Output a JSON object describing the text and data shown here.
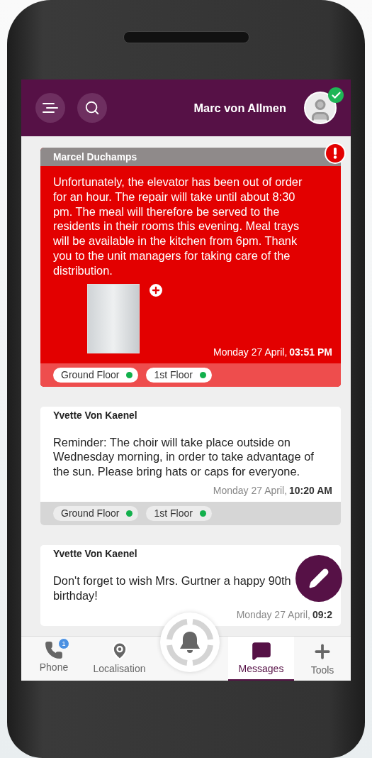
{
  "header": {
    "user_name": "Marc von Allmen",
    "online": true
  },
  "messages": [
    {
      "sender": "Marcel Duchamps",
      "urgent": true,
      "text": "Unfortunately, the elevator has been out of order for an hour. The repair will take until about 8:30 pm. The meal will therefore be served to the residents in their rooms this evening. Meal trays will be available in the kitchen from 6pm. Thank you to the unit managers for taking care of the distribution.",
      "has_photo": true,
      "date": "Monday 27 April,",
      "time": "03:51 PM",
      "tags": [
        "Ground Floor",
        "1st Floor"
      ]
    },
    {
      "sender": "Yvette Von Kaenel",
      "urgent": false,
      "text": "Reminder: The choir will take place outside on Wednesday morning, in order to take advantage of the sun. Please bring hats or caps for everyone.",
      "has_photo": false,
      "date": "Monday 27 April,",
      "time": "10:20 AM",
      "tags": [
        "Ground Floor",
        "1st Floor"
      ]
    },
    {
      "sender": "Yvette Von Kaenel",
      "urgent": false,
      "text": "Don't forget to wish Mrs. Gurtner a happy 90th birthday!",
      "has_photo": false,
      "date": "Monday 27 April,",
      "time": "09:2"
    }
  ],
  "nav": [
    {
      "kind": "phone",
      "label": "Phone",
      "badge": "1",
      "selected": false
    },
    {
      "kind": "location",
      "label": "Localisation",
      "selected": false
    },
    {
      "kind": "alarm",
      "selected": false
    },
    {
      "kind": "messages",
      "label": "Messages",
      "selected": true
    },
    {
      "kind": "tools",
      "label": "Tools",
      "selected": false
    }
  ]
}
